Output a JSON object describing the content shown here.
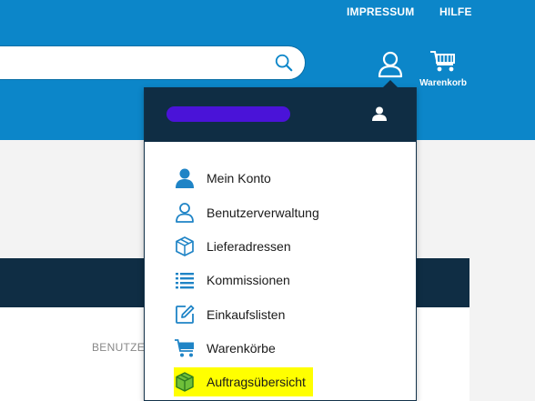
{
  "topnav": {
    "impressum": "IMPRESSUM",
    "hilfe": "HILFE"
  },
  "search": {
    "value": "",
    "placeholder": ""
  },
  "cart": {
    "label": "Warenkorb"
  },
  "content": {
    "truncated_text": "BENUTZE"
  },
  "account_menu": {
    "items": [
      {
        "label": "Mein Konto",
        "icon": "user-filled-icon"
      },
      {
        "label": "Benutzerverwaltung",
        "icon": "user-outline-icon"
      },
      {
        "label": "Lieferadressen",
        "icon": "box-icon"
      },
      {
        "label": "Kommissionen",
        "icon": "list-icon"
      },
      {
        "label": "Einkaufslisten",
        "icon": "edit-icon"
      },
      {
        "label": "Warenkörbe",
        "icon": "cart-icon"
      },
      {
        "label": "Auftragsübersicht",
        "icon": "package-icon",
        "highlighted": true
      }
    ]
  },
  "colors": {
    "brand_blue": "#0c86c9",
    "dark_navy": "#0f2d44",
    "icon_blue": "#1f84c6",
    "highlight": "#ffff00",
    "redacted": "#4a13d8"
  }
}
